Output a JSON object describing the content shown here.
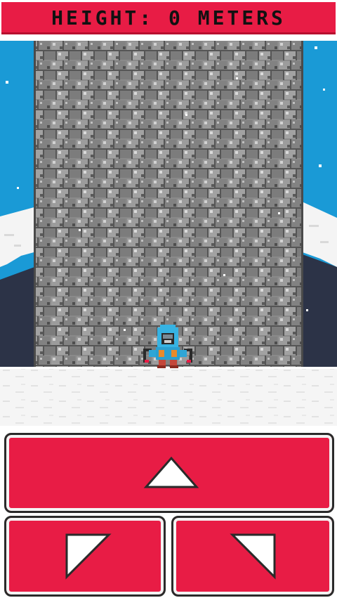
{
  "hud": {
    "height_label": "HEIGHT: 0 METERS"
  },
  "colors": {
    "accent": "#e81c45",
    "sky": "#1a9ad6",
    "snow": "#f7f7f7",
    "rock": "#7a7a7a",
    "mountain": "#2c3347"
  },
  "controls": {
    "up_icon": "triangle-up-icon",
    "left_icon": "diagonal-left-icon",
    "right_icon": "diagonal-right-icon"
  }
}
